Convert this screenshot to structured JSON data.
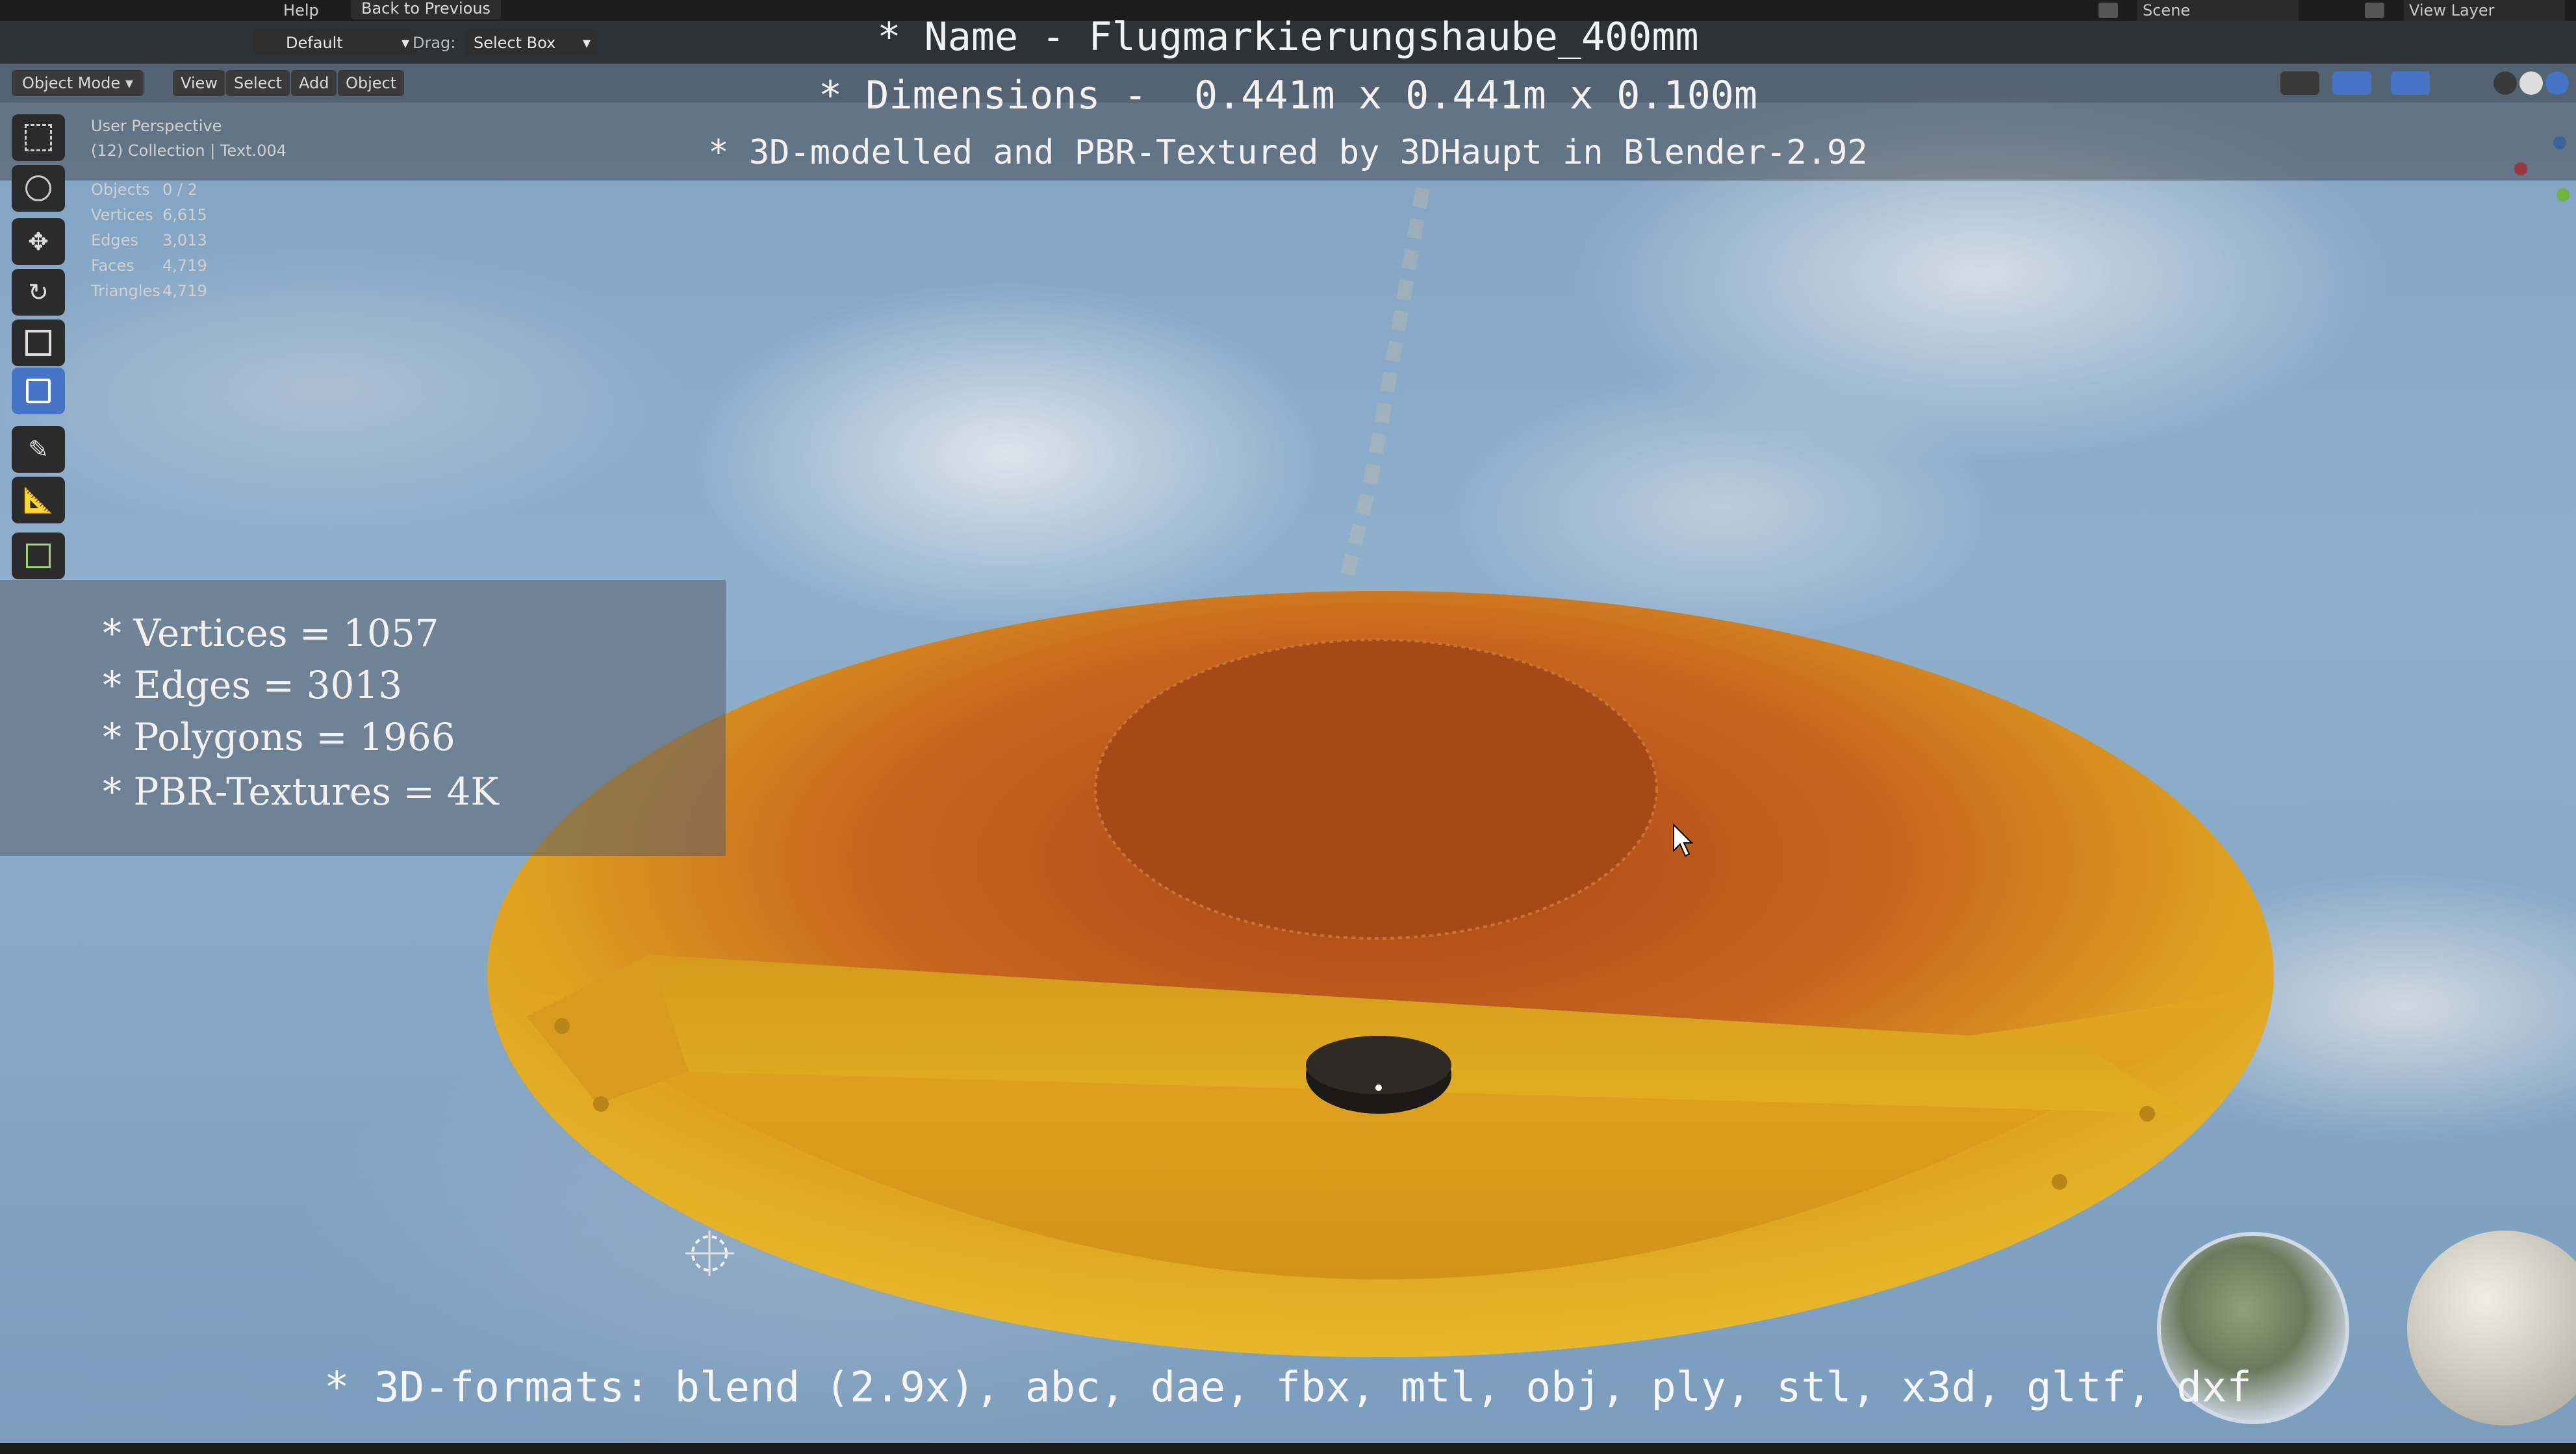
{
  "menubar": {
    "items": [
      "Help"
    ],
    "back_to_previous": "Back to Previous",
    "scene_label": "Scene",
    "view_layer_label": "View Layer"
  },
  "header": {
    "orientation_value": "Default",
    "drag_label": "Drag:",
    "drag_value": "Select Box"
  },
  "viewport_header": {
    "mode": "Object Mode",
    "menus": [
      "View",
      "Select",
      "Add",
      "Object"
    ]
  },
  "viewport_info": {
    "perspective": "User Perspective",
    "collection": "(12) Collection | Text.004",
    "stats": [
      {
        "label": "Objects",
        "value": "0 / 2"
      },
      {
        "label": "Vertices",
        "value": "6,615"
      },
      {
        "label": "Edges",
        "value": "3,013"
      },
      {
        "label": "Faces",
        "value": "4,719"
      },
      {
        "label": "Triangles",
        "value": "4,719"
      }
    ]
  },
  "overlay_title": {
    "name_line": "* Name - Flugmarkierungshaube_400mm",
    "dimensions_line": "* Dimensions -  0.441m x 0.441m x 0.100m",
    "credit_line": "* 3D-modelled and PBR-Textured by 3DHaupt in Blender-2.92"
  },
  "info_panel": {
    "lines": [
      "* Vertices = 1057",
      "* Edges = 3013",
      "* Polygons = 1966",
      "* PBR-Textures = 4K"
    ]
  },
  "formats_line": "* 3D-formats: blend (2.9x), abc, dae, fbx, mtl, obj, ply, stl, x3d, gltf, dxf",
  "colors": {
    "accent": "#4674c6",
    "marker_yellow": "#e2ac1a",
    "marker_orange": "#b9531c"
  }
}
